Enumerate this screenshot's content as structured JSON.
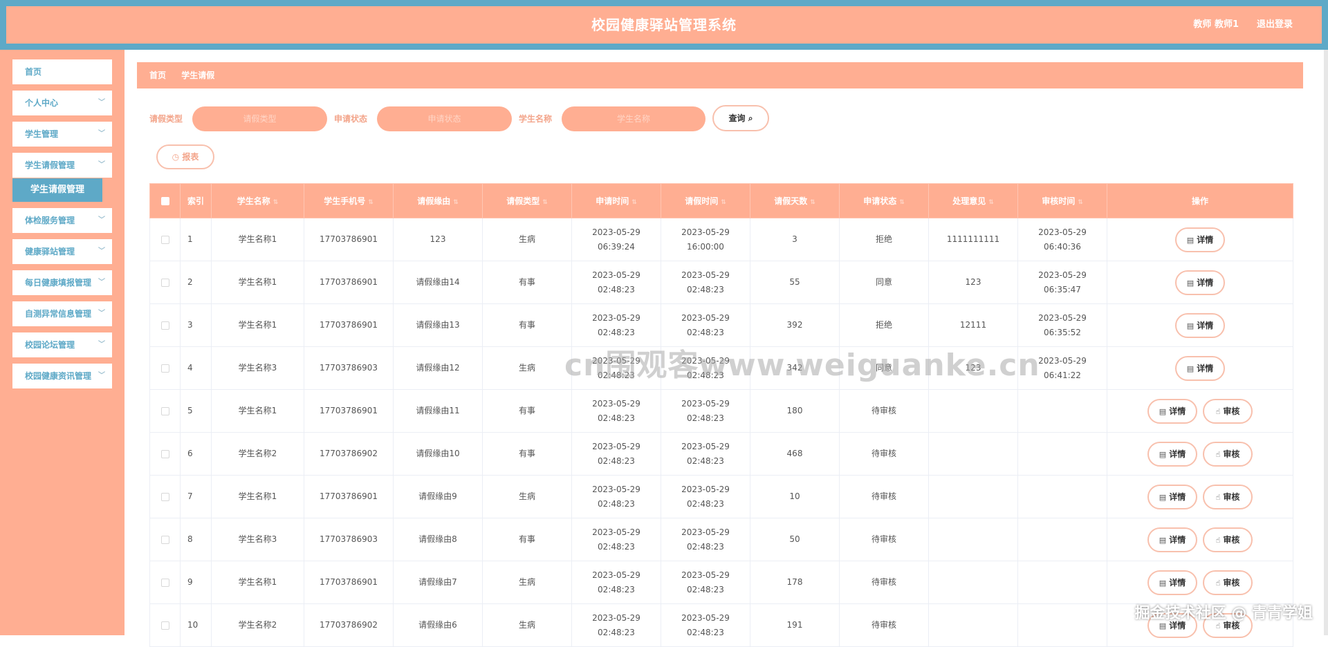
{
  "header": {
    "title": "校园健康驿站管理系统",
    "user": "教师 教师1",
    "logout": "退出登录"
  },
  "sidebar": {
    "items": [
      {
        "label": "首页",
        "chevron": false
      },
      {
        "label": "个人中心",
        "chevron": true
      },
      {
        "label": "学生管理",
        "chevron": true
      },
      {
        "label": "学生请假管理",
        "chevron": true
      },
      {
        "label": "体检服务管理",
        "chevron": true
      },
      {
        "label": "健康驿站管理",
        "chevron": true
      },
      {
        "label": "每日健康填报管理",
        "chevron": true
      },
      {
        "label": "自测异常信息管理",
        "chevron": true
      },
      {
        "label": "校园论坛管理",
        "chevron": true
      },
      {
        "label": "校园健康资讯管理",
        "chevron": true
      }
    ],
    "active_sub": "学生请假管理"
  },
  "breadcrumb": [
    "首页",
    "学生请假"
  ],
  "filters": {
    "leave_type_label": "请假类型",
    "leave_type_placeholder": "请假类型",
    "status_label": "申请状态",
    "status_placeholder": "申请状态",
    "student_name_label": "学生名称",
    "student_name_placeholder": "学生名称",
    "query_button": "查询",
    "report_button": "报表"
  },
  "table": {
    "columns": [
      "索引",
      "学生名称",
      "学生手机号",
      "请假缘由",
      "请假类型",
      "申请时间",
      "请假时间",
      "请假天数",
      "申请状态",
      "处理意见",
      "审核时间",
      "操作"
    ],
    "detail_label": "详情",
    "audit_label": "审核",
    "rows": [
      {
        "index": "1",
        "name": "学生名称1",
        "phone": "17703786901",
        "reason": "123",
        "type": "生病",
        "apply_time": "2023-05-29 06:39:24",
        "leave_time": "2023-05-29 16:00:00",
        "days": "3",
        "status": "拒绝",
        "opinion": "1111111111",
        "review_time": "2023-05-29 06:40:36",
        "can_audit": false
      },
      {
        "index": "2",
        "name": "学生名称1",
        "phone": "17703786901",
        "reason": "请假缘由14",
        "type": "有事",
        "apply_time": "2023-05-29 02:48:23",
        "leave_time": "2023-05-29 02:48:23",
        "days": "55",
        "status": "同意",
        "opinion": "123",
        "review_time": "2023-05-29 06:35:47",
        "can_audit": false
      },
      {
        "index": "3",
        "name": "学生名称1",
        "phone": "17703786901",
        "reason": "请假缘由13",
        "type": "有事",
        "apply_time": "2023-05-29 02:48:23",
        "leave_time": "2023-05-29 02:48:23",
        "days": "392",
        "status": "拒绝",
        "opinion": "12111",
        "review_time": "2023-05-29 06:35:52",
        "can_audit": false
      },
      {
        "index": "4",
        "name": "学生名称3",
        "phone": "17703786903",
        "reason": "请假缘由12",
        "type": "生病",
        "apply_time": "2023-05-29 02:48:23",
        "leave_time": "2023-05-29 02:48:23",
        "days": "342",
        "status": "同意",
        "opinion": "123",
        "review_time": "2023-05-29 06:41:22",
        "can_audit": false
      },
      {
        "index": "5",
        "name": "学生名称1",
        "phone": "17703786901",
        "reason": "请假缘由11",
        "type": "有事",
        "apply_time": "2023-05-29 02:48:23",
        "leave_time": "2023-05-29 02:48:23",
        "days": "180",
        "status": "待审核",
        "opinion": "",
        "review_time": "",
        "can_audit": true
      },
      {
        "index": "6",
        "name": "学生名称2",
        "phone": "17703786902",
        "reason": "请假缘由10",
        "type": "有事",
        "apply_time": "2023-05-29 02:48:23",
        "leave_time": "2023-05-29 02:48:23",
        "days": "468",
        "status": "待审核",
        "opinion": "",
        "review_time": "",
        "can_audit": true
      },
      {
        "index": "7",
        "name": "学生名称1",
        "phone": "17703786901",
        "reason": "请假缘由9",
        "type": "生病",
        "apply_time": "2023-05-29 02:48:23",
        "leave_time": "2023-05-29 02:48:23",
        "days": "10",
        "status": "待审核",
        "opinion": "",
        "review_time": "",
        "can_audit": true
      },
      {
        "index": "8",
        "name": "学生名称3",
        "phone": "17703786903",
        "reason": "请假缘由8",
        "type": "有事",
        "apply_time": "2023-05-29 02:48:23",
        "leave_time": "2023-05-29 02:48:23",
        "days": "50",
        "status": "待审核",
        "opinion": "",
        "review_time": "",
        "can_audit": true
      },
      {
        "index": "9",
        "name": "学生名称1",
        "phone": "17703786901",
        "reason": "请假缘由7",
        "type": "生病",
        "apply_time": "2023-05-29 02:48:23",
        "leave_time": "2023-05-29 02:48:23",
        "days": "178",
        "status": "待审核",
        "opinion": "",
        "review_time": "",
        "can_audit": true
      },
      {
        "index": "10",
        "name": "学生名称2",
        "phone": "17703786902",
        "reason": "请假缘由6",
        "type": "生病",
        "apply_time": "2023-05-29 02:48:23",
        "leave_time": "2023-05-29 02:48:23",
        "days": "191",
        "status": "待审核",
        "opinion": "",
        "review_time": "",
        "can_audit": true
      }
    ]
  },
  "watermark": "cn围观客www.weiguanke.cn",
  "corner_mark": "掘金技术社区 @ 青青学姐"
}
